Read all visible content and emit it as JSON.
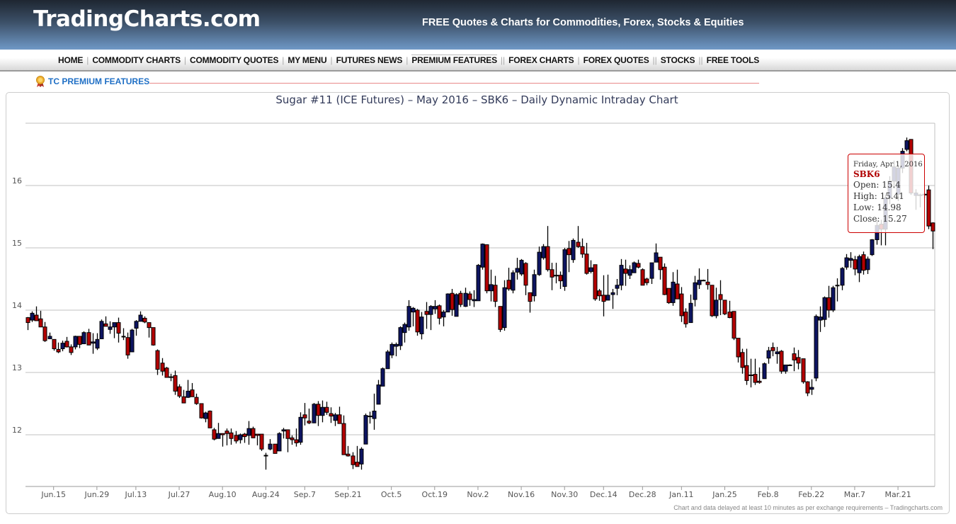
{
  "header": {
    "logo": "TradingCharts.com",
    "tagline": "FREE Quotes & Charts for Commodities, Forex, Stocks & Equities"
  },
  "nav": {
    "items": [
      {
        "label": "HOME",
        "sep": "|"
      },
      {
        "label": "COMMODITY CHARTS",
        "sep": "|"
      },
      {
        "label": "COMMODITY QUOTES",
        "sep": "|"
      },
      {
        "label": "MY MENU",
        "sep": "|"
      },
      {
        "label": "FUTURES NEWS",
        "sep": "|"
      },
      {
        "label": "PREMIUM FEATURES",
        "sep": "||"
      },
      {
        "label": "FOREX CHARTS",
        "sep": "|"
      },
      {
        "label": "FOREX QUOTES",
        "sep": "||"
      },
      {
        "label": "STOCKS",
        "sep": "||"
      },
      {
        "label": "FREE TOOLS",
        "sep": ""
      }
    ]
  },
  "premium": {
    "label": "TC PREMIUM FEATURES",
    "icon": "award-ribbon-icon"
  },
  "footnote": "Chart and data delayed at least 10 minutes as per exchange requirements – Tradingcharts.com",
  "tooltip": {
    "date": "Friday, Apr 1, 2016",
    "symbol": "SBK6",
    "open": "Open: 15.4",
    "high": "High: 15.41",
    "low": "Low: 14.98",
    "close": "Close: 15.27"
  },
  "colors": {
    "up": "#0d1461",
    "down": "#b40000",
    "grid": "#c0c0c0"
  },
  "chart_data": {
    "type": "candlestick",
    "title": "Sugar #11 (ICE Futures) – May 2016 – SBK6 – Daily Dynamic Intraday Chart",
    "ylim": [
      11.17,
      17
    ],
    "y_ticks": [
      12,
      13,
      14,
      15,
      16
    ],
    "grid": true,
    "x_ticks": [
      {
        "label": "Jun.15",
        "index": 6
      },
      {
        "label": "Jun.29",
        "index": 16
      },
      {
        "label": "Jul.13",
        "index": 25
      },
      {
        "label": "Jul.27",
        "index": 35
      },
      {
        "label": "Aug.10",
        "index": 45
      },
      {
        "label": "Aug.24",
        "index": 55
      },
      {
        "label": "Sep.7",
        "index": 64
      },
      {
        "label": "Sep.21",
        "index": 74
      },
      {
        "label": "Oct.5",
        "index": 84
      },
      {
        "label": "Oct.19",
        "index": 94
      },
      {
        "label": "Nov.2",
        "index": 104
      },
      {
        "label": "Nov.16",
        "index": 114
      },
      {
        "label": "Nov.30",
        "index": 124
      },
      {
        "label": "Dec.14",
        "index": 133
      },
      {
        "label": "Dec.28",
        "index": 142
      },
      {
        "label": "Jan.11",
        "index": 151
      },
      {
        "label": "Jan.25",
        "index": 161
      },
      {
        "label": "Feb.8",
        "index": 171
      },
      {
        "label": "Feb.22",
        "index": 181
      },
      {
        "label": "Mar.7",
        "index": 191
      },
      {
        "label": "Mar.21",
        "index": 201
      }
    ],
    "highlighted_index": 209,
    "ohlc": [
      [
        13.88,
        13.89,
        13.68,
        13.8
      ],
      [
        13.84,
        13.98,
        13.81,
        13.95
      ],
      [
        13.92,
        14.06,
        13.83,
        13.83
      ],
      [
        13.86,
        13.99,
        13.73,
        13.73
      ],
      [
        13.73,
        13.81,
        13.49,
        13.51
      ],
      [
        13.54,
        13.64,
        13.54,
        13.58
      ],
      [
        13.53,
        13.53,
        13.35,
        13.38
      ],
      [
        13.37,
        13.48,
        13.31,
        13.33
      ],
      [
        13.38,
        13.51,
        13.34,
        13.47
      ],
      [
        13.5,
        13.57,
        13.4,
        13.41
      ],
      [
        13.41,
        13.45,
        13.28,
        13.32
      ],
      [
        13.41,
        13.59,
        13.37,
        13.58
      ],
      [
        13.58,
        13.58,
        13.39,
        13.45
      ],
      [
        13.46,
        13.66,
        13.46,
        13.64
      ],
      [
        13.64,
        13.7,
        13.44,
        13.44
      ],
      [
        13.47,
        13.63,
        13.3,
        13.49
      ],
      [
        13.39,
        13.63,
        13.36,
        13.53
      ],
      [
        13.54,
        13.85,
        13.54,
        13.82
      ],
      [
        13.78,
        13.9,
        13.74,
        13.74
      ],
      [
        13.69,
        13.82,
        13.62,
        13.73
      ],
      [
        13.73,
        13.8,
        13.55,
        13.8
      ],
      [
        13.8,
        13.88,
        13.48,
        13.63
      ],
      [
        13.58,
        13.71,
        13.52,
        13.58
      ],
      [
        13.56,
        13.64,
        13.22,
        13.28
      ],
      [
        13.33,
        13.7,
        13.33,
        13.68
      ],
      [
        13.71,
        13.84,
        13.59,
        13.82
      ],
      [
        13.82,
        13.98,
        13.82,
        13.92
      ],
      [
        13.87,
        13.9,
        13.79,
        13.81
      ],
      [
        13.8,
        13.8,
        13.56,
        13.72
      ],
      [
        13.72,
        13.72,
        13.43,
        13.44
      ],
      [
        13.35,
        13.37,
        12.96,
        13.05
      ],
      [
        13.15,
        13.23,
        12.95,
        13.02
      ],
      [
        13.07,
        13.09,
        12.92,
        12.92
      ],
      [
        12.93,
        12.98,
        12.86,
        12.92
      ],
      [
        12.95,
        13.03,
        12.64,
        12.7
      ],
      [
        12.77,
        12.81,
        12.59,
        12.62
      ],
      [
        12.61,
        12.72,
        12.51,
        12.51
      ],
      [
        12.6,
        12.88,
        12.59,
        12.7
      ],
      [
        12.72,
        12.83,
        12.61,
        12.61
      ],
      [
        12.6,
        12.66,
        12.48,
        12.5
      ],
      [
        12.5,
        12.5,
        12.26,
        12.27
      ],
      [
        12.26,
        12.37,
        12.2,
        12.35
      ],
      [
        12.38,
        12.39,
        12.11,
        12.11
      ],
      [
        12.08,
        12.11,
        11.91,
        11.93
      ],
      [
        11.94,
        12.19,
        11.94,
        12.02
      ],
      [
        12.02,
        12.02,
        11.81,
        12.0
      ],
      [
        12.06,
        12.1,
        11.83,
        12.02
      ],
      [
        12.03,
        12.1,
        11.84,
        11.94
      ],
      [
        11.99,
        12.06,
        11.86,
        11.9
      ],
      [
        11.92,
        12.02,
        11.86,
        12.0
      ],
      [
        12.01,
        12.03,
        11.87,
        11.97
      ],
      [
        11.99,
        12.22,
        11.84,
        12.1
      ],
      [
        12.1,
        12.13,
        11.95,
        11.95
      ],
      [
        12.01,
        12.01,
        11.83,
        11.99
      ],
      [
        12.01,
        12.01,
        11.74,
        11.77
      ],
      [
        11.67,
        11.71,
        11.44,
        11.67
      ],
      [
        11.77,
        11.93,
        11.75,
        11.85
      ],
      [
        11.85,
        11.85,
        11.71,
        11.7
      ],
      [
        11.74,
        12.04,
        11.74,
        12.02
      ],
      [
        12.06,
        12.11,
        11.94,
        12.08
      ],
      [
        12.08,
        12.08,
        11.72,
        11.94
      ],
      [
        11.95,
        11.99,
        11.84,
        11.92
      ],
      [
        11.92,
        12.1,
        11.81,
        11.87
      ],
      [
        11.88,
        12.36,
        11.84,
        12.28
      ],
      [
        12.32,
        12.51,
        12.15,
        12.27
      ],
      [
        12.22,
        12.42,
        12.17,
        12.19
      ],
      [
        12.19,
        12.51,
        12.19,
        12.49
      ],
      [
        12.49,
        12.54,
        12.14,
        12.31
      ],
      [
        12.31,
        12.55,
        12.2,
        12.44
      ],
      [
        12.44,
        12.53,
        12.32,
        12.36
      ],
      [
        12.34,
        12.44,
        12.19,
        12.3
      ],
      [
        12.23,
        12.35,
        12.14,
        12.32
      ],
      [
        12.32,
        12.45,
        12.18,
        12.18
      ],
      [
        12.18,
        12.31,
        11.68,
        11.68
      ],
      [
        11.69,
        11.82,
        11.65,
        11.66
      ],
      [
        11.66,
        11.72,
        11.45,
        11.52
      ],
      [
        11.56,
        11.82,
        11.49,
        11.49
      ],
      [
        11.53,
        11.8,
        11.44,
        11.77
      ],
      [
        11.85,
        12.34,
        11.85,
        12.31
      ],
      [
        12.3,
        12.37,
        12.18,
        12.3
      ],
      [
        12.26,
        12.66,
        12.08,
        12.38
      ],
      [
        12.49,
        12.88,
        12.49,
        12.8
      ],
      [
        12.78,
        13.08,
        12.78,
        13.06
      ],
      [
        13.06,
        13.36,
        13.06,
        13.33
      ],
      [
        13.28,
        13.48,
        13.23,
        13.45
      ],
      [
        13.42,
        13.48,
        13.26,
        13.45
      ],
      [
        13.43,
        13.74,
        13.36,
        13.72
      ],
      [
        13.64,
        13.8,
        13.48,
        13.77
      ],
      [
        13.73,
        14.16,
        13.67,
        14.06
      ],
      [
        13.97,
        14.05,
        13.74,
        14.03
      ],
      [
        14.0,
        14.02,
        13.59,
        13.65
      ],
      [
        13.62,
        13.97,
        13.53,
        13.89
      ],
      [
        13.98,
        14.13,
        13.7,
        13.93
      ],
      [
        13.93,
        14.08,
        13.68,
        14.06
      ],
      [
        14.02,
        14.16,
        13.94,
        14.06
      ],
      [
        14.07,
        14.09,
        13.77,
        13.87
      ],
      [
        13.89,
        14.0,
        13.74,
        13.97
      ],
      [
        13.97,
        14.27,
        13.97,
        14.26
      ],
      [
        14.27,
        14.34,
        13.91,
        14.01
      ],
      [
        13.9,
        14.27,
        13.9,
        14.25
      ],
      [
        14.27,
        14.31,
        14.05,
        14.09
      ],
      [
        14.06,
        14.36,
        14.05,
        14.27
      ],
      [
        14.26,
        14.3,
        14.07,
        14.17
      ],
      [
        14.15,
        14.32,
        14.05,
        14.17
      ],
      [
        14.15,
        14.74,
        14.15,
        14.72
      ],
      [
        14.69,
        15.07,
        14.65,
        15.06
      ],
      [
        15.05,
        15.05,
        14.27,
        14.31
      ],
      [
        14.31,
        14.65,
        14.14,
        14.41
      ],
      [
        14.4,
        14.55,
        14.05,
        14.14
      ],
      [
        14.06,
        14.06,
        13.65,
        13.69
      ],
      [
        13.72,
        14.48,
        13.67,
        14.36
      ],
      [
        14.48,
        14.68,
        14.31,
        14.34
      ],
      [
        14.32,
        14.64,
        14.27,
        14.6
      ],
      [
        14.61,
        14.84,
        14.49,
        14.67
      ],
      [
        14.58,
        14.82,
        14.55,
        14.8
      ],
      [
        14.75,
        14.77,
        14.24,
        14.4
      ],
      [
        14.28,
        14.28,
        13.96,
        14.14
      ],
      [
        14.23,
        14.65,
        14.14,
        14.57
      ],
      [
        14.57,
        15.02,
        14.55,
        14.93
      ],
      [
        14.84,
        15.06,
        14.81,
        15.02
      ],
      [
        15.02,
        15.35,
        14.62,
        14.65
      ],
      [
        14.65,
        14.76,
        14.32,
        14.53
      ],
      [
        14.56,
        14.76,
        14.43,
        14.56
      ],
      [
        14.56,
        14.62,
        14.34,
        14.47
      ],
      [
        14.38,
        15.0,
        14.31,
        14.97
      ],
      [
        14.99,
        15.11,
        14.61,
        14.89
      ],
      [
        14.81,
        15.15,
        14.76,
        15.12
      ],
      [
        15.09,
        15.35,
        15.0,
        15.02
      ],
      [
        15.02,
        15.15,
        14.84,
        14.9
      ],
      [
        14.9,
        15.08,
        14.57,
        14.59
      ],
      [
        14.62,
        14.8,
        14.59,
        14.68
      ],
      [
        14.73,
        14.73,
        14.15,
        14.18
      ],
      [
        14.31,
        14.34,
        14.15,
        14.23
      ],
      [
        14.24,
        14.56,
        13.9,
        14.14
      ],
      [
        14.16,
        14.57,
        14.16,
        14.24
      ],
      [
        14.25,
        14.34,
        14.02,
        14.28
      ],
      [
        14.35,
        14.5,
        14.24,
        14.4
      ],
      [
        14.4,
        14.82,
        14.32,
        14.72
      ],
      [
        14.66,
        14.81,
        14.39,
        14.59
      ],
      [
        14.56,
        14.72,
        14.5,
        14.65
      ],
      [
        14.6,
        14.78,
        14.6,
        14.76
      ],
      [
        14.75,
        14.81,
        14.67,
        14.69
      ],
      [
        14.65,
        14.67,
        14.4,
        14.4
      ],
      [
        14.5,
        14.52,
        14.4,
        14.44
      ],
      [
        14.51,
        14.76,
        14.42,
        14.76
      ],
      [
        14.77,
        15.07,
        14.77,
        14.92
      ],
      [
        14.85,
        14.85,
        14.49,
        14.65
      ],
      [
        14.69,
        14.75,
        14.24,
        14.25
      ],
      [
        14.35,
        14.35,
        14.1,
        14.12
      ],
      [
        14.12,
        14.61,
        14.07,
        14.45
      ],
      [
        14.42,
        14.65,
        14.18,
        14.18
      ],
      [
        14.26,
        14.37,
        13.81,
        13.91
      ],
      [
        13.97,
        14.03,
        13.72,
        13.78
      ],
      [
        13.8,
        14.25,
        13.8,
        14.11
      ],
      [
        14.17,
        14.55,
        14.06,
        14.44
      ],
      [
        14.41,
        14.67,
        14.34,
        14.48
      ],
      [
        14.48,
        14.49,
        14.47,
        14.48
      ],
      [
        14.45,
        14.66,
        14.33,
        14.41
      ],
      [
        14.4,
        14.4,
        13.89,
        13.91
      ],
      [
        13.91,
        14.36,
        13.87,
        14.16
      ],
      [
        14.25,
        14.48,
        13.92,
        14.17
      ],
      [
        14.16,
        14.16,
        13.92,
        13.94
      ],
      [
        13.97,
        14.15,
        13.87,
        13.88
      ],
      [
        13.98,
        13.98,
        13.52,
        13.55
      ],
      [
        13.55,
        13.55,
        13.16,
        13.25
      ],
      [
        13.32,
        13.38,
        12.98,
        13.08
      ],
      [
        13.11,
        13.38,
        12.8,
        12.87
      ],
      [
        12.96,
        13.22,
        12.76,
        12.96
      ],
      [
        12.97,
        13.22,
        12.8,
        12.84
      ],
      [
        12.86,
        13.08,
        12.82,
        12.84
      ],
      [
        12.9,
        13.16,
        12.9,
        13.14
      ],
      [
        13.23,
        13.41,
        13.14,
        13.35
      ],
      [
        13.4,
        13.48,
        13.26,
        13.35
      ],
      [
        13.3,
        13.41,
        13.14,
        13.33
      ],
      [
        13.34,
        13.36,
        12.98,
        13.02
      ],
      [
        13.02,
        13.12,
        12.98,
        13.12
      ],
      [
        13.12,
        13.13,
        13.11,
        13.12
      ],
      [
        13.3,
        13.4,
        13.02,
        13.2
      ],
      [
        13.24,
        13.36,
        13.05,
        13.15
      ],
      [
        13.22,
        13.22,
        12.82,
        12.85
      ],
      [
        12.85,
        12.86,
        12.62,
        12.67
      ],
      [
        12.73,
        12.89,
        12.64,
        12.76
      ],
      [
        12.91,
        13.93,
        12.86,
        13.9
      ],
      [
        13.84,
        14.06,
        13.65,
        13.89
      ],
      [
        13.85,
        14.22,
        13.73,
        14.2
      ],
      [
        14.2,
        14.39,
        13.88,
        14.0
      ],
      [
        14.0,
        14.39,
        13.97,
        14.36
      ],
      [
        14.4,
        14.51,
        14.14,
        14.4
      ],
      [
        14.4,
        14.69,
        14.32,
        14.67
      ],
      [
        14.69,
        14.9,
        14.65,
        14.84
      ],
      [
        14.8,
        14.93,
        14.68,
        14.83
      ],
      [
        14.81,
        14.87,
        14.56,
        14.66
      ],
      [
        14.6,
        14.89,
        14.45,
        14.86
      ],
      [
        14.89,
        14.94,
        14.57,
        14.64
      ],
      [
        14.65,
        14.86,
        14.58,
        14.82
      ],
      [
        14.89,
        15.14,
        14.87,
        15.13
      ],
      [
        15.13,
        15.45,
        15.05,
        15.36
      ],
      [
        15.38,
        15.45,
        15.04,
        15.3
      ],
      [
        15.3,
        15.85,
        15.04,
        15.8
      ],
      [
        15.8,
        16.15,
        15.7,
        16.07
      ],
      [
        16.07,
        16.4,
        15.95,
        16.3
      ],
      [
        15.86,
        16.32,
        15.75,
        16.28
      ],
      [
        16.28,
        16.6,
        16.2,
        16.55
      ],
      [
        16.58,
        16.77,
        16.55,
        16.72
      ],
      [
        16.74,
        16.74,
        15.85,
        15.88
      ],
      [
        15.84,
        15.94,
        15.61,
        15.88
      ],
      [
        15.84,
        15.87,
        15.65,
        15.85
      ],
      [
        15.86,
        15.88,
        15.8,
        15.86
      ],
      [
        15.93,
        16.0,
        15.3,
        15.35
      ],
      [
        15.4,
        15.41,
        14.98,
        15.27
      ]
    ]
  }
}
